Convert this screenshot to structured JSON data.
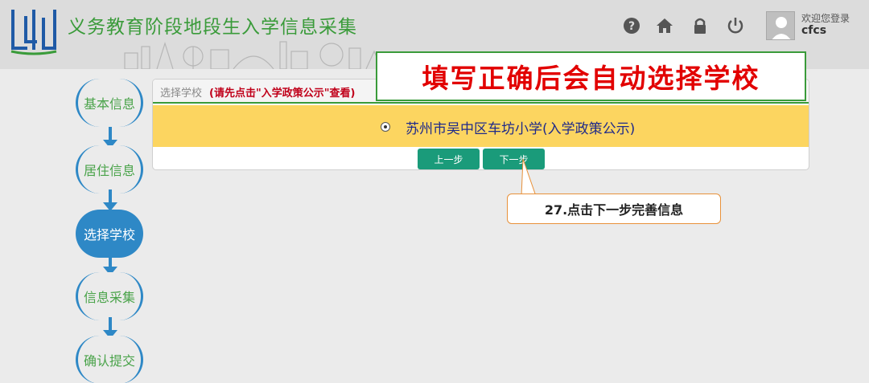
{
  "header": {
    "title": "义务教育阶段地段生入学信息采集",
    "welcome": "欢迎您登录",
    "username": "cfcs",
    "icons": [
      "help-icon",
      "home-icon",
      "lock-icon",
      "power-icon",
      "user-avatar-icon"
    ]
  },
  "steps": [
    {
      "label": "基本信息",
      "state": "inactive"
    },
    {
      "label": "居住信息",
      "state": "inactive"
    },
    {
      "label": "选择学校",
      "state": "active"
    },
    {
      "label": "信息采集",
      "state": "inactive"
    },
    {
      "label": "确认提交",
      "state": "inactive"
    }
  ],
  "panel": {
    "heading": "选择学校",
    "note": "(请先点击\"入学政策公示\"查看)",
    "school": "苏州市吴中区车坊小学",
    "policy_link": "(入学政策公示)",
    "prev_button": "上一步",
    "next_button": "下一步"
  },
  "annotations": {
    "banner": "填写正确后会自动选择学校",
    "callout": "27.点击下一步完善信息"
  },
  "colors": {
    "title_green": "#3a9b3a",
    "step_blue": "#2e88c6",
    "school_row": "#fcd560",
    "button_teal": "#1a9b7a",
    "banner_red": "#e20000"
  }
}
